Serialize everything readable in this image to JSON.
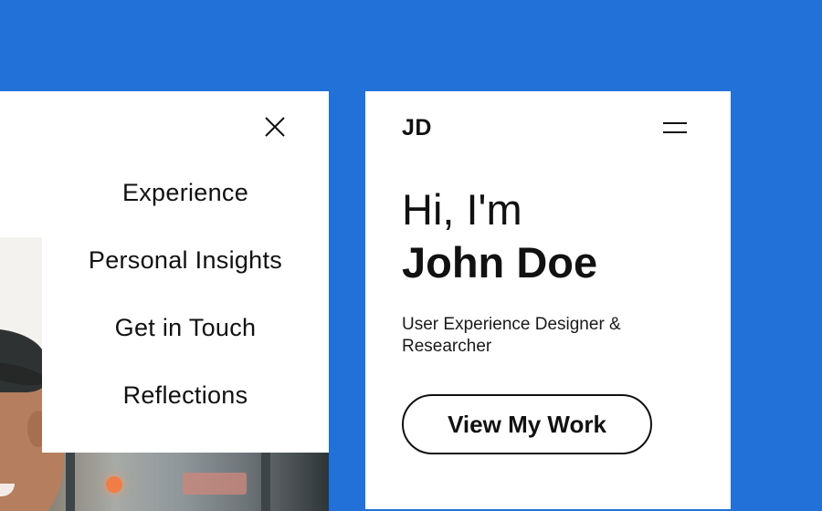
{
  "menu": {
    "close_icon": "close-icon",
    "items": [
      {
        "label": "Experience"
      },
      {
        "label": "Personal Insights"
      },
      {
        "label": "Get in Touch"
      },
      {
        "label": "Reflections"
      }
    ]
  },
  "hero": {
    "logo": "JD",
    "menu_icon": "hamburger-icon",
    "greeting": "Hi, I'm",
    "name": "John Doe",
    "role": "User Experience Designer & Researcher",
    "cta_label": "View My Work"
  },
  "colors": {
    "background": "#2171d9",
    "surface": "#ffffff",
    "text": "#111111"
  }
}
